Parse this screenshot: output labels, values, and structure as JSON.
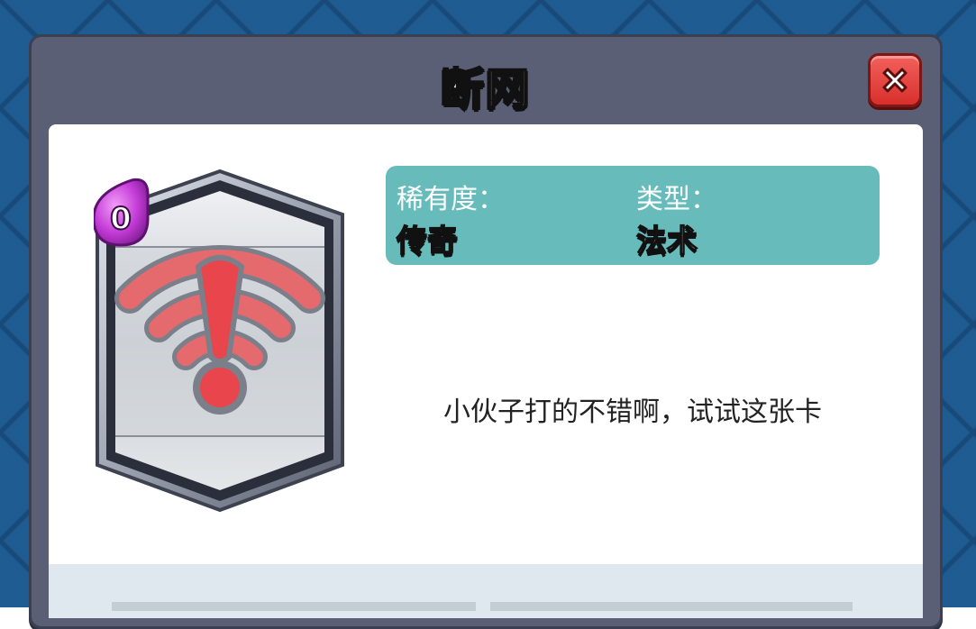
{
  "dialog": {
    "title": "断网",
    "close_icon": "close-x-icon"
  },
  "card": {
    "elixir_cost": "0",
    "art_icon": "wifi-disconnected-warning-icon"
  },
  "info": {
    "rarity_label": "稀有度：",
    "rarity_value": "传奇",
    "type_label": "类型：",
    "type_value": "法术"
  },
  "description": "小伙子打的不错啊，试试这张卡",
  "colors": {
    "rarity_legendary": "#a6f068",
    "type_value": "#ffffff",
    "info_box": "#67bbbb",
    "close_button": "#e8403b",
    "elixir": "#c23ad6"
  }
}
